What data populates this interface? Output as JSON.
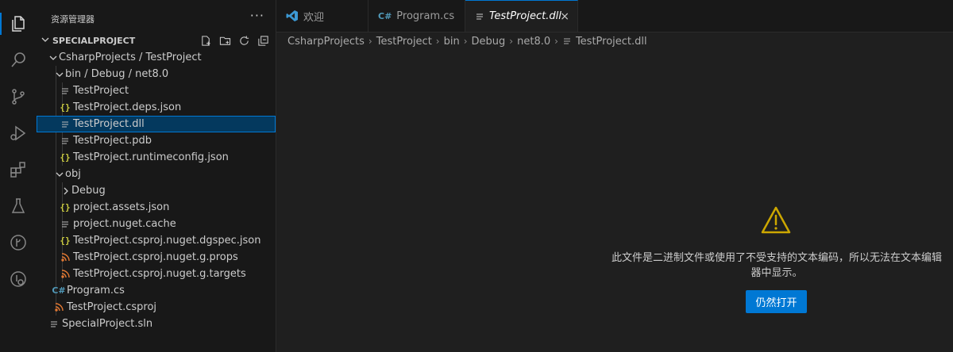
{
  "activity_bar": {
    "icons": [
      "explorer-icon",
      "search-icon",
      "source-control-icon",
      "run-debug-icon",
      "extensions-icon",
      "testing-icon",
      "git-graph-icon",
      "remote-icon"
    ]
  },
  "explorer": {
    "title": "资源管理器",
    "more": "···",
    "project": "SPECIALPROJECT",
    "tree": [
      {
        "label": "CsharpProjects / TestProject",
        "type": "folder",
        "expanded": true,
        "depth": 0
      },
      {
        "label": "bin / Debug / net8.0",
        "type": "folder",
        "expanded": true,
        "depth": 1
      },
      {
        "label": "TestProject",
        "type": "file",
        "icon": "lines",
        "depth": 2
      },
      {
        "label": "TestProject.deps.json",
        "type": "file",
        "icon": "json",
        "depth": 2
      },
      {
        "label": "TestProject.dll",
        "type": "file",
        "icon": "lines",
        "depth": 2,
        "selected": true
      },
      {
        "label": "TestProject.pdb",
        "type": "file",
        "icon": "lines",
        "depth": 2
      },
      {
        "label": "TestProject.runtimeconfig.json",
        "type": "file",
        "icon": "json",
        "depth": 2
      },
      {
        "label": "obj",
        "type": "folder",
        "expanded": true,
        "depth": 1
      },
      {
        "label": "Debug",
        "type": "folder",
        "expanded": false,
        "depth": 2
      },
      {
        "label": "project.assets.json",
        "type": "file",
        "icon": "json",
        "depth": 2
      },
      {
        "label": "project.nuget.cache",
        "type": "file",
        "icon": "lines",
        "depth": 2
      },
      {
        "label": "TestProject.csproj.nuget.dgspec.json",
        "type": "file",
        "icon": "json",
        "depth": 2
      },
      {
        "label": "TestProject.csproj.nuget.g.props",
        "type": "file",
        "icon": "rss",
        "depth": 2
      },
      {
        "label": "TestProject.csproj.nuget.g.targets",
        "type": "file",
        "icon": "rss",
        "depth": 2
      },
      {
        "label": "Program.cs",
        "type": "file",
        "icon": "cs",
        "depth": 1
      },
      {
        "label": "TestProject.csproj",
        "type": "file",
        "icon": "rss",
        "depth": 1
      },
      {
        "label": "SpecialProject.sln",
        "type": "file",
        "icon": "lines",
        "depth": 0
      }
    ]
  },
  "tabs": [
    {
      "label": "欢迎",
      "icon": "vscode-icon"
    },
    {
      "label": "Program.cs",
      "icon": "csharp-icon"
    },
    {
      "label": "TestProject.dll",
      "icon": "file-lines-icon",
      "active": true,
      "close": "×"
    }
  ],
  "breadcrumbs": [
    "CsharpProjects",
    "TestProject",
    "bin",
    "Debug",
    "net8.0",
    "TestProject.dll"
  ],
  "editor": {
    "message_line1": "此文件是二进制文件或使用了不受支持的文本编码，所以无法在文本编辑",
    "message_line2": "器中显示。",
    "open_anyway": "仍然打开"
  },
  "colors": {
    "accent": "#0078d4",
    "warning": "#cca700",
    "selection": "#04395e"
  }
}
